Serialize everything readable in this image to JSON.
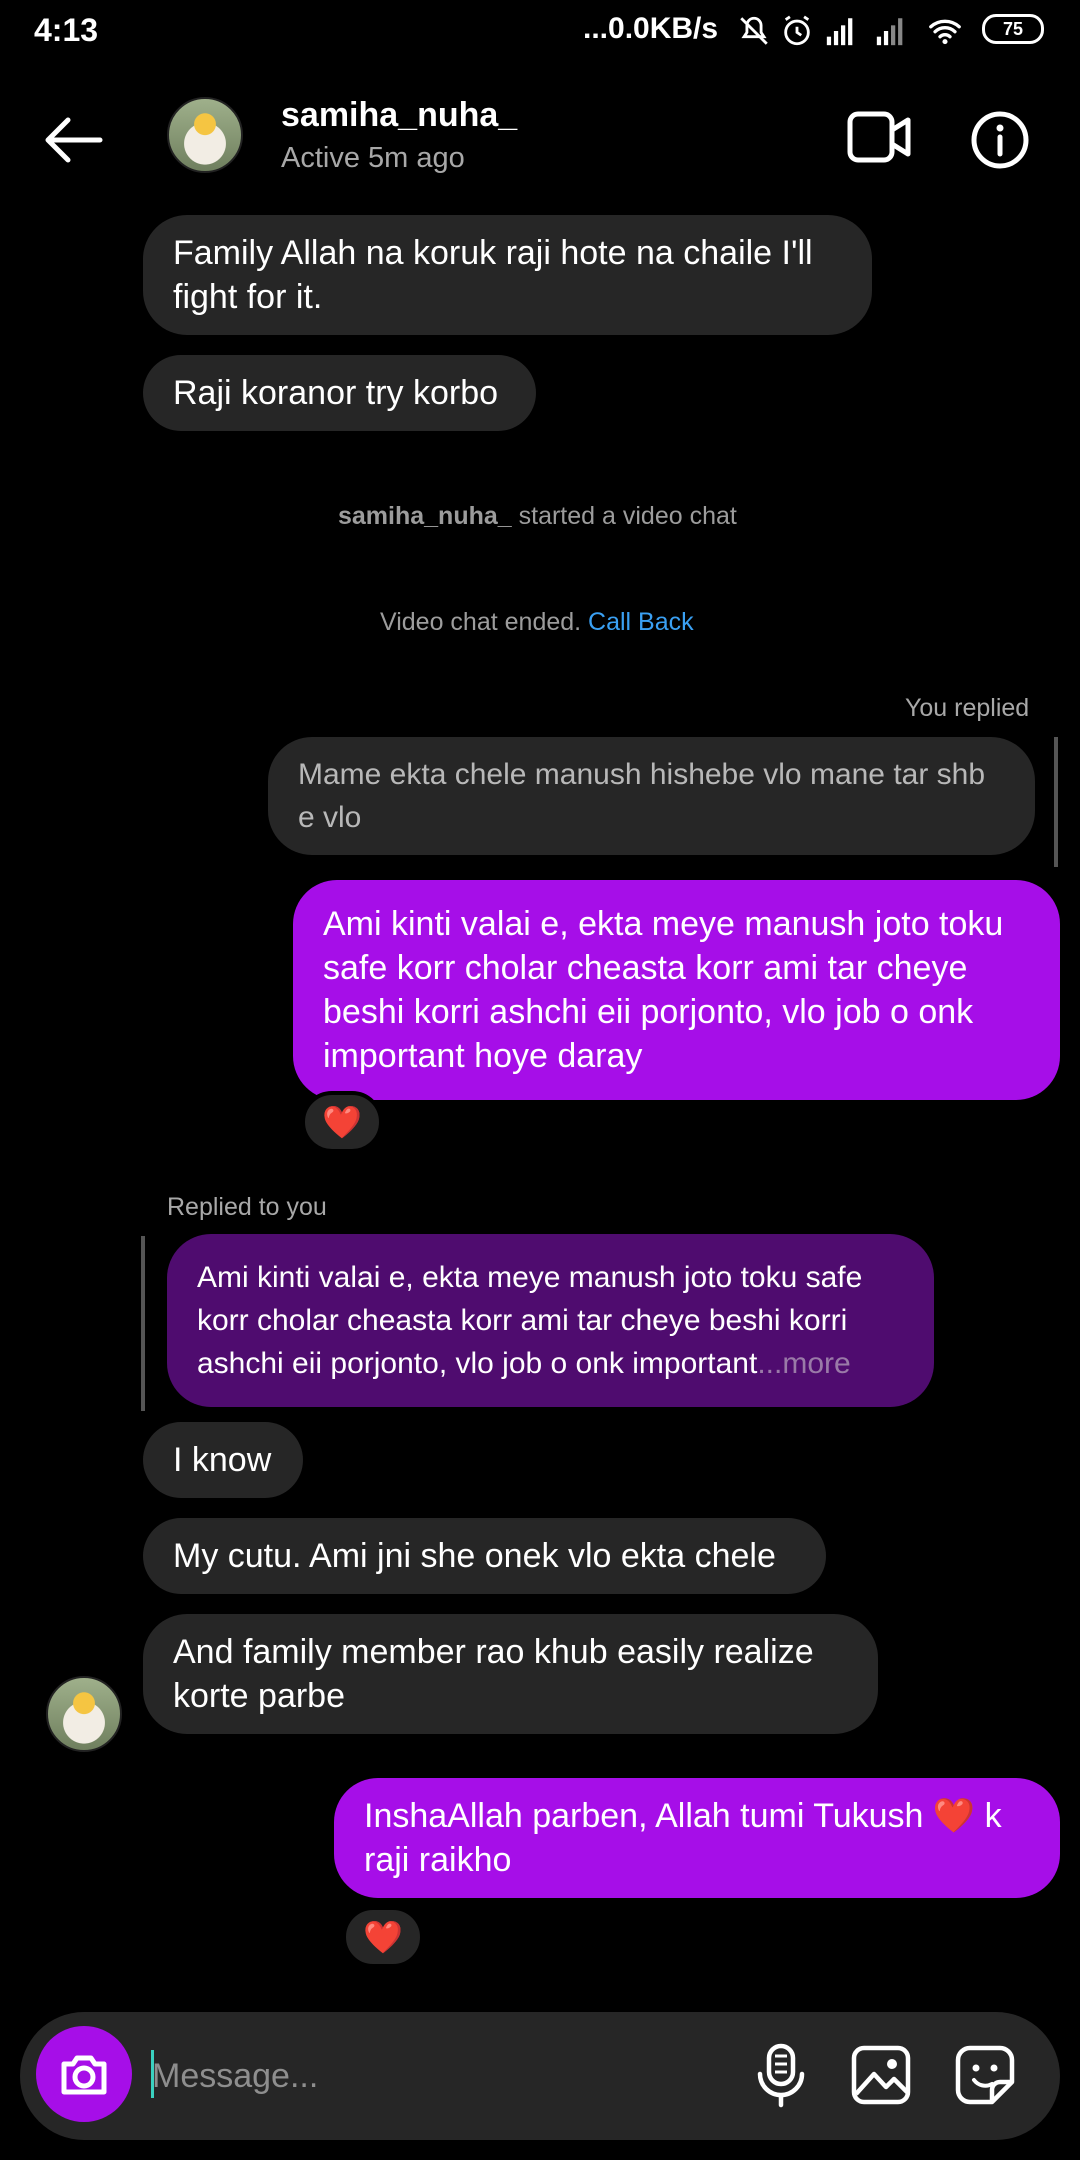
{
  "status_bar": {
    "time": "4:13",
    "network_speed": "...0.0KB/s",
    "battery": "75"
  },
  "header": {
    "username": "samiha_nuha_",
    "activity": "Active 5m ago"
  },
  "messages": {
    "m1": "Family Allah na koruk raji hote na chaile I'll fight for it.",
    "m2": "Raji koranor try korbo",
    "system1_user": "samiha_nuha_",
    "system1_text": " started a video chat",
    "system2_text": "Video chat ended. ",
    "system2_link": "Call Back",
    "you_replied_label": "You replied",
    "quoted_out": "Mame ekta chele manush hishebe vlo mane tar shb e vlo",
    "out1": "Ami kinti valai e, ekta meye manush joto toku safe korr cholar cheasta korr ami tar cheye beshi korri ashchi eii porjonto, vlo job o onk important hoye daray",
    "out1_reaction": "❤️",
    "replied_to_you_label": "Replied to you",
    "quoted_in": "Ami kinti valai e, ekta meye manush joto toku safe korr cholar cheasta korr ami tar cheye beshi korri ashchi eii porjonto, vlo job o onk important",
    "quoted_in_more": "...more",
    "m3": "I know",
    "m4": "My cutu. Ami jni she onek vlo ekta chele",
    "m5": "And family member rao khub easily realize korte parbe",
    "out2": "InshaAllah parben, Allah tumi Tukush ❤️ k raji raikho",
    "out2_reaction": "❤️"
  },
  "composer": {
    "placeholder": "Message..."
  },
  "colors": {
    "outgoing_bubble": "#a60ee8",
    "incoming_bubble": "#262626",
    "quoted_incoming": "#4f0c6f",
    "link": "#3aa0f3"
  }
}
